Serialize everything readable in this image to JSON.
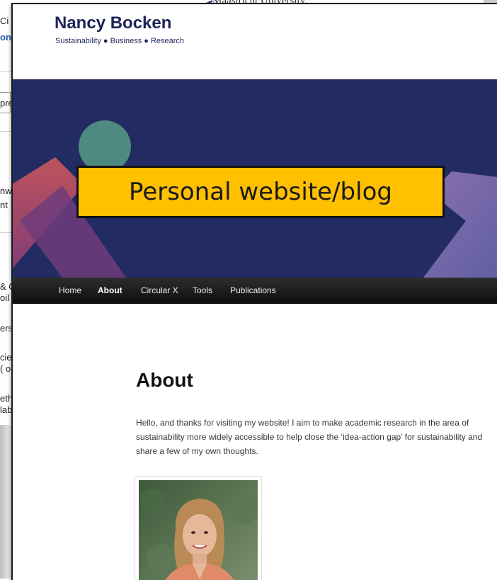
{
  "background_window": {
    "top_caption": "Maastricht University,",
    "fragments": [
      "Ci",
      "ont",
      "pre",
      "nw",
      "nt",
      "& C",
      "oil",
      "ers",
      "cie",
      "( o",
      "eth",
      "lab"
    ]
  },
  "site": {
    "title": "Nancy Bocken",
    "tagline": "Sustainability ● Business ● Research",
    "callout": "Personal website/blog",
    "nav": [
      {
        "label": "Home",
        "active": false
      },
      {
        "label": "About",
        "active": true
      },
      {
        "label": "Circular X",
        "active": false
      },
      {
        "label": "Tools",
        "active": false
      },
      {
        "label": "Publications",
        "active": false
      }
    ],
    "page_heading": "About",
    "intro": "Hello, and thanks for visiting my website! I aim to make academic research in the area of sustainability more widely accessible to help close the ‘idea-action gap’ for sustainability and share a few of my own thoughts.",
    "photo_icon": "portrait-photo"
  },
  "colors": {
    "title": "#1c2457",
    "banner": "#232c62",
    "callout": "#ffc000",
    "navbar": "#111111"
  }
}
